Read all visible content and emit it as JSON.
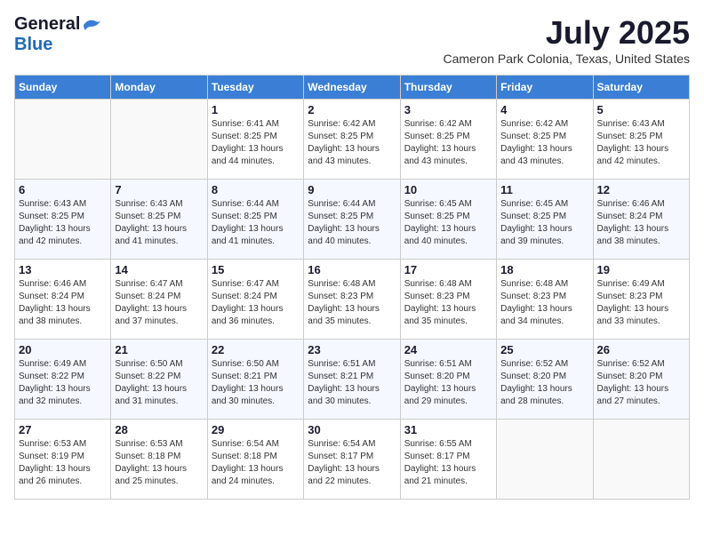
{
  "logo": {
    "general": "General",
    "blue": "Blue"
  },
  "title": "July 2025",
  "location": "Cameron Park Colonia, Texas, United States",
  "weekdays": [
    "Sunday",
    "Monday",
    "Tuesday",
    "Wednesday",
    "Thursday",
    "Friday",
    "Saturday"
  ],
  "weeks": [
    [
      {
        "day": "",
        "info": ""
      },
      {
        "day": "",
        "info": ""
      },
      {
        "day": "1",
        "info": "Sunrise: 6:41 AM\nSunset: 8:25 PM\nDaylight: 13 hours and 44 minutes."
      },
      {
        "day": "2",
        "info": "Sunrise: 6:42 AM\nSunset: 8:25 PM\nDaylight: 13 hours and 43 minutes."
      },
      {
        "day": "3",
        "info": "Sunrise: 6:42 AM\nSunset: 8:25 PM\nDaylight: 13 hours and 43 minutes."
      },
      {
        "day": "4",
        "info": "Sunrise: 6:42 AM\nSunset: 8:25 PM\nDaylight: 13 hours and 43 minutes."
      },
      {
        "day": "5",
        "info": "Sunrise: 6:43 AM\nSunset: 8:25 PM\nDaylight: 13 hours and 42 minutes."
      }
    ],
    [
      {
        "day": "6",
        "info": "Sunrise: 6:43 AM\nSunset: 8:25 PM\nDaylight: 13 hours and 42 minutes."
      },
      {
        "day": "7",
        "info": "Sunrise: 6:43 AM\nSunset: 8:25 PM\nDaylight: 13 hours and 41 minutes."
      },
      {
        "day": "8",
        "info": "Sunrise: 6:44 AM\nSunset: 8:25 PM\nDaylight: 13 hours and 41 minutes."
      },
      {
        "day": "9",
        "info": "Sunrise: 6:44 AM\nSunset: 8:25 PM\nDaylight: 13 hours and 40 minutes."
      },
      {
        "day": "10",
        "info": "Sunrise: 6:45 AM\nSunset: 8:25 PM\nDaylight: 13 hours and 40 minutes."
      },
      {
        "day": "11",
        "info": "Sunrise: 6:45 AM\nSunset: 8:25 PM\nDaylight: 13 hours and 39 minutes."
      },
      {
        "day": "12",
        "info": "Sunrise: 6:46 AM\nSunset: 8:24 PM\nDaylight: 13 hours and 38 minutes."
      }
    ],
    [
      {
        "day": "13",
        "info": "Sunrise: 6:46 AM\nSunset: 8:24 PM\nDaylight: 13 hours and 38 minutes."
      },
      {
        "day": "14",
        "info": "Sunrise: 6:47 AM\nSunset: 8:24 PM\nDaylight: 13 hours and 37 minutes."
      },
      {
        "day": "15",
        "info": "Sunrise: 6:47 AM\nSunset: 8:24 PM\nDaylight: 13 hours and 36 minutes."
      },
      {
        "day": "16",
        "info": "Sunrise: 6:48 AM\nSunset: 8:23 PM\nDaylight: 13 hours and 35 minutes."
      },
      {
        "day": "17",
        "info": "Sunrise: 6:48 AM\nSunset: 8:23 PM\nDaylight: 13 hours and 35 minutes."
      },
      {
        "day": "18",
        "info": "Sunrise: 6:48 AM\nSunset: 8:23 PM\nDaylight: 13 hours and 34 minutes."
      },
      {
        "day": "19",
        "info": "Sunrise: 6:49 AM\nSunset: 8:23 PM\nDaylight: 13 hours and 33 minutes."
      }
    ],
    [
      {
        "day": "20",
        "info": "Sunrise: 6:49 AM\nSunset: 8:22 PM\nDaylight: 13 hours and 32 minutes."
      },
      {
        "day": "21",
        "info": "Sunrise: 6:50 AM\nSunset: 8:22 PM\nDaylight: 13 hours and 31 minutes."
      },
      {
        "day": "22",
        "info": "Sunrise: 6:50 AM\nSunset: 8:21 PM\nDaylight: 13 hours and 30 minutes."
      },
      {
        "day": "23",
        "info": "Sunrise: 6:51 AM\nSunset: 8:21 PM\nDaylight: 13 hours and 30 minutes."
      },
      {
        "day": "24",
        "info": "Sunrise: 6:51 AM\nSunset: 8:20 PM\nDaylight: 13 hours and 29 minutes."
      },
      {
        "day": "25",
        "info": "Sunrise: 6:52 AM\nSunset: 8:20 PM\nDaylight: 13 hours and 28 minutes."
      },
      {
        "day": "26",
        "info": "Sunrise: 6:52 AM\nSunset: 8:20 PM\nDaylight: 13 hours and 27 minutes."
      }
    ],
    [
      {
        "day": "27",
        "info": "Sunrise: 6:53 AM\nSunset: 8:19 PM\nDaylight: 13 hours and 26 minutes."
      },
      {
        "day": "28",
        "info": "Sunrise: 6:53 AM\nSunset: 8:18 PM\nDaylight: 13 hours and 25 minutes."
      },
      {
        "day": "29",
        "info": "Sunrise: 6:54 AM\nSunset: 8:18 PM\nDaylight: 13 hours and 24 minutes."
      },
      {
        "day": "30",
        "info": "Sunrise: 6:54 AM\nSunset: 8:17 PM\nDaylight: 13 hours and 22 minutes."
      },
      {
        "day": "31",
        "info": "Sunrise: 6:55 AM\nSunset: 8:17 PM\nDaylight: 13 hours and 21 minutes."
      },
      {
        "day": "",
        "info": ""
      },
      {
        "day": "",
        "info": ""
      }
    ]
  ]
}
